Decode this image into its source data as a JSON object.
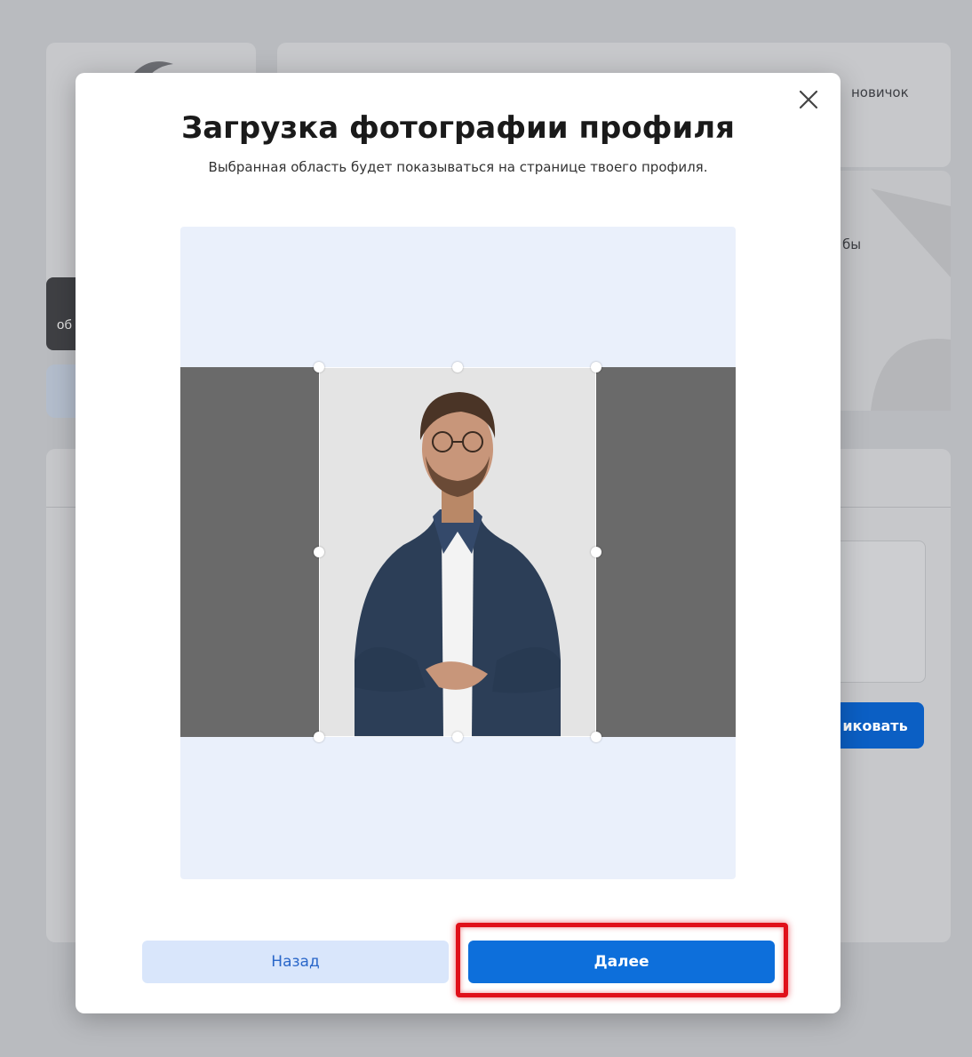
{
  "background": {
    "header_rank": "новичок",
    "card_partial_text": "бы",
    "tab_partial_text": "об",
    "publish_button_partial": "иковать"
  },
  "modal": {
    "title": "Загрузка фотографии профиля",
    "subtitle": "Выбранная область будет показываться на странице твоего профиля.",
    "close_icon": "close-icon",
    "crop": {
      "image_subject": "person-photo"
    },
    "buttons": {
      "back_label": "Назад",
      "next_label": "Далее"
    },
    "highlight_color": "#e0101a",
    "accent_color": "#0d6fdb"
  }
}
